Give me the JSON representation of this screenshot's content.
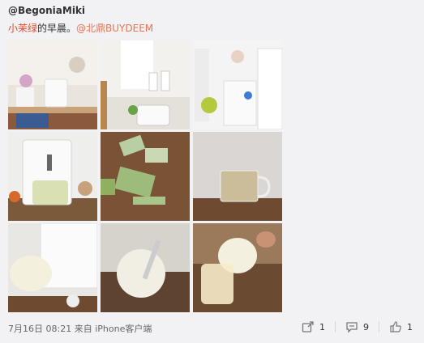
{
  "post": {
    "author": "@BegoniaMiki",
    "text_highlight": "小茉绿",
    "text_plain": "的早晨。",
    "mention": "@北鼎BUYDEEM"
  },
  "photos": [
    {
      "id": "p1",
      "desc": "kitchen-shelf-with-dispenser"
    },
    {
      "id": "p2",
      "desc": "window-kitchen-with-cups"
    },
    {
      "id": "p3",
      "desc": "white-room-with-plant-and-cart"
    },
    {
      "id": "p4",
      "desc": "water-dispenser-and-tea-jug"
    },
    {
      "id": "p5",
      "desc": "green-tea-sachets-on-wood"
    },
    {
      "id": "p6",
      "desc": "glass-jug-with-milk-tea"
    },
    {
      "id": "p7",
      "desc": "pouring-milk-from-dispenser"
    },
    {
      "id": "p8",
      "desc": "jug-of-milk-with-stirrer"
    },
    {
      "id": "p9",
      "desc": "pouring-milk-into-glass"
    }
  ],
  "footer": {
    "time": "7月16日 08:21",
    "source_prefix": "来自",
    "source": "iPhone客户端",
    "share_count": "1",
    "comment_count": "9",
    "like_count": "1"
  },
  "icons": {
    "share": "share-icon",
    "comment": "comment-icon",
    "like": "thumbs-up-icon"
  }
}
